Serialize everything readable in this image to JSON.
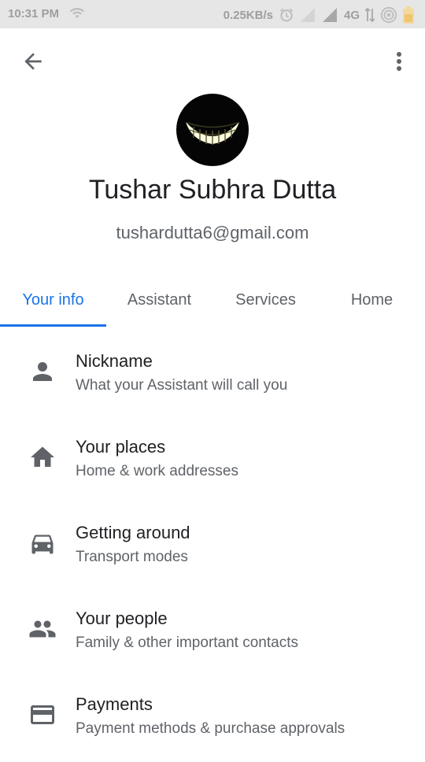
{
  "status_bar": {
    "time": "10:31 PM",
    "net_speed": "0.25KB/s",
    "network": "4G"
  },
  "top_bar": {
    "back_icon": "arrow-back-icon",
    "menu_icon": "more-vert-icon"
  },
  "profile": {
    "name": "Tushar Subhra Dutta",
    "email": "tushardutta6@gmail.com"
  },
  "tabs": [
    {
      "label": "Your info",
      "active": true
    },
    {
      "label": "Assistant",
      "active": false
    },
    {
      "label": "Services",
      "active": false
    },
    {
      "label": "Home",
      "active": false
    }
  ],
  "colors": {
    "accent": "#1a73e8",
    "icon": "#5f6368"
  },
  "items": [
    {
      "title": "Nickname",
      "subtitle": "What your Assistant will call you",
      "icon": "person-icon"
    },
    {
      "title": "Your places",
      "subtitle": "Home & work addresses",
      "icon": "home-icon"
    },
    {
      "title": "Getting around",
      "subtitle": "Transport modes",
      "icon": "car-icon"
    },
    {
      "title": "Your people",
      "subtitle": "Family & other important contacts",
      "icon": "people-icon"
    },
    {
      "title": "Payments",
      "subtitle": "Payment methods & purchase approvals",
      "icon": "credit-card-icon"
    }
  ]
}
